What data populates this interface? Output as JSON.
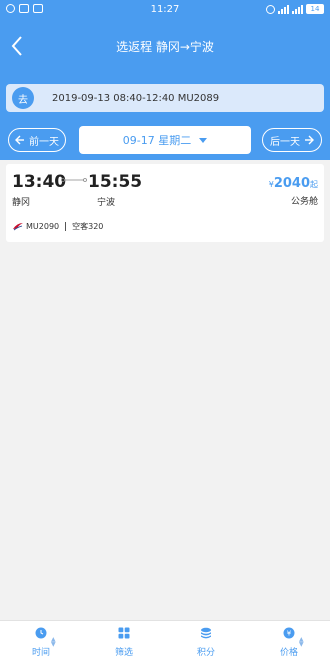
{
  "status_bar": {
    "time": "11:27",
    "battery": "14"
  },
  "header": {
    "title": "选返程 静冈→宁波"
  },
  "outbound": {
    "badge": "去",
    "info": "2019-09-13  08:40-12:40 MU2089"
  },
  "date_nav": {
    "prev_label": "前一天",
    "current_date": "09-17 星期二",
    "next_label": "后一天"
  },
  "flight": {
    "dep_time": "13:40",
    "arr_time": "15:55",
    "dep_city": "静冈",
    "arr_city": "宁波",
    "currency": "¥",
    "price": "2040",
    "price_suffix": "起",
    "cabin": "公务舱",
    "flight_no": "MU2090",
    "aircraft": "空客320",
    "airline_logo_icon": "china-eastern-logo",
    "airline_color": "#c8102e"
  },
  "bottom_tabs": [
    {
      "label": "时间",
      "icon": "clock-icon"
    },
    {
      "label": "筛选",
      "icon": "grid-icon"
    },
    {
      "label": "积分",
      "icon": "coins-icon"
    },
    {
      "label": "价格",
      "icon": "yen-icon"
    }
  ],
  "colors": {
    "primary": "#4a9cf0",
    "background": "#f2f2f2"
  }
}
